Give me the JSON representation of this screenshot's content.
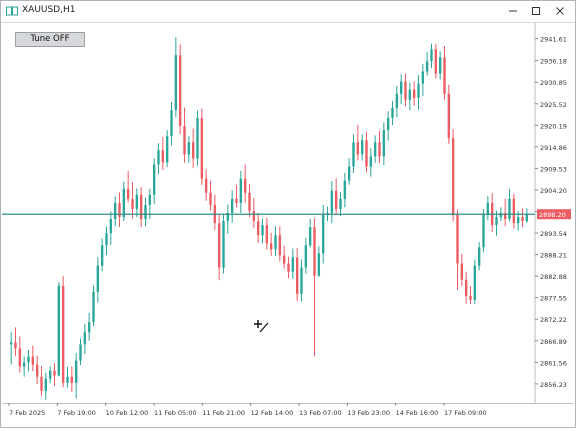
{
  "window": {
    "title": "XAUUSD,H1",
    "controls": {
      "minimize": "minimize-icon",
      "maximize": "maximize-icon",
      "close": "close-icon"
    }
  },
  "toolbar": {
    "tune_label": "Tune OFF"
  },
  "colors": {
    "bull": "#2aa69a",
    "bear": "#ec5c63",
    "grid_border": "#b8bec4",
    "price_line": "#2f8f83",
    "price_label_bg": "#ec5c63"
  },
  "chart_data": {
    "type": "candlestick",
    "symbol": "XAUUSD",
    "timeframe": "H1",
    "ylim": [
      2851.5,
      2945.5
    ],
    "y_ticks": [
      "2941.61",
      "2936.18",
      "2930.85",
      "2925.52",
      "2920.19",
      "2914.86",
      "2909.53",
      "2904.20",
      "2898.87",
      "2893.54",
      "2888.21",
      "2882.88",
      "2877.55",
      "2872.22",
      "2866.89",
      "2861.56",
      "2856.23"
    ],
    "x_ticks": [
      "7 Feb 2025",
      "7 Feb 19:00",
      "10 Feb 12:00",
      "11 Feb 05:00",
      "11 Feb 21:00",
      "12 Feb 14:00",
      "13 Feb 07:00",
      "13 Feb 23:00",
      "14 Feb 16:00",
      "17 Feb 09:00"
    ],
    "current_price": "2898.20",
    "current_price_value": 2898.2,
    "cursor_icon": "crosshair-cursor-icon",
    "candles": [
      [
        2866.0,
        2869.0,
        2861.0,
        2866.5
      ],
      [
        2866.5,
        2870.2,
        2863.2,
        2865.0
      ],
      [
        2865.0,
        2868.0,
        2859.0,
        2860.5
      ],
      [
        2860.5,
        2863.0,
        2858.0,
        2861.5
      ],
      [
        2861.5,
        2864.6,
        2859.3,
        2863.0
      ],
      [
        2863.0,
        2865.7,
        2859.4,
        2861.0
      ],
      [
        2861.0,
        2863.2,
        2856.2,
        2858.0
      ],
      [
        2858.0,
        2860.7,
        2853.2,
        2854.5
      ],
      [
        2854.5,
        2859.0,
        2852.3,
        2857.5
      ],
      [
        2857.5,
        2860.6,
        2856.4,
        2859.5
      ],
      [
        2859.5,
        2861.4,
        2855.6,
        2858.3
      ],
      [
        2858.3,
        2881.4,
        2858.1,
        2880.5
      ],
      [
        2880.5,
        2882.9,
        2855.4,
        2856.5
      ],
      [
        2856.5,
        2860.5,
        2855.3,
        2858.0
      ],
      [
        2858.0,
        2860.6,
        2854.2,
        2856.5
      ],
      [
        2856.5,
        2863.9,
        2852.6,
        2862.0
      ],
      [
        2862.0,
        2867.5,
        2860.9,
        2866.0
      ],
      [
        2866.0,
        2871.1,
        2863.6,
        2869.0
      ],
      [
        2869.0,
        2873.8,
        2866.9,
        2871.5
      ],
      [
        2871.5,
        2880.6,
        2870.5,
        2879.0
      ],
      [
        2879.0,
        2887.6,
        2876.3,
        2885.5
      ],
      [
        2885.5,
        2892.2,
        2884.1,
        2890.5
      ],
      [
        2890.5,
        2895.2,
        2888.1,
        2893.5
      ],
      [
        2893.5,
        2898.9,
        2890.6,
        2897.0
      ],
      [
        2897.0,
        2902.6,
        2895.2,
        2901.0
      ],
      [
        2901.0,
        2903.6,
        2895.0,
        2897.5
      ],
      [
        2897.5,
        2906.3,
        2896.5,
        2904.5
      ],
      [
        2904.5,
        2908.9,
        2901.1,
        2902.0
      ],
      [
        2902.0,
        2906.2,
        2897.1,
        2899.5
      ],
      [
        2899.5,
        2904.6,
        2897.5,
        2903.0
      ],
      [
        2903.0,
        2904.9,
        2895.0,
        2897.0
      ],
      [
        2897.0,
        2902.3,
        2895.2,
        2900.5
      ],
      [
        2900.5,
        2904.5,
        2897.0,
        2903.0
      ],
      [
        2903.0,
        2912.0,
        2900.7,
        2910.5
      ],
      [
        2910.5,
        2915.8,
        2908.1,
        2914.0
      ],
      [
        2914.0,
        2917.3,
        2909.1,
        2911.0
      ],
      [
        2911.0,
        2919.0,
        2909.9,
        2917.5
      ],
      [
        2917.5,
        2926.0,
        2915.2,
        2924.0
      ],
      [
        2924.0,
        2942.0,
        2922.2,
        2937.5
      ],
      [
        2937.5,
        2940.2,
        2918.0,
        2920.0
      ],
      [
        2920.0,
        2924.6,
        2910.9,
        2913.0
      ],
      [
        2913.0,
        2917.5,
        2910.9,
        2916.0
      ],
      [
        2916.0,
        2919.4,
        2909.6,
        2912.0
      ],
      [
        2912.0,
        2923.9,
        2910.2,
        2922.0
      ],
      [
        2922.0,
        2924.3,
        2905.4,
        2907.0
      ],
      [
        2907.0,
        2909.3,
        2901.5,
        2903.5
      ],
      [
        2903.5,
        2906.5,
        2899.1,
        2900.5
      ],
      [
        2900.5,
        2903.0,
        2894.3,
        2896.0
      ],
      [
        2896.0,
        2898.0,
        2881.9,
        2885.0
      ],
      [
        2885.0,
        2898.3,
        2883.5,
        2896.5
      ],
      [
        2896.5,
        2900.6,
        2893.3,
        2898.5
      ],
      [
        2898.5,
        2904.1,
        2896.1,
        2902.0
      ],
      [
        2902.0,
        2905.5,
        2899.9,
        2901.0
      ],
      [
        2901.0,
        2908.9,
        2898.5,
        2907.0
      ],
      [
        2907.0,
        2910.5,
        2901.1,
        2903.5
      ],
      [
        2903.5,
        2905.6,
        2897.4,
        2899.0
      ],
      [
        2899.0,
        2902.2,
        2894.8,
        2896.5
      ],
      [
        2896.5,
        2898.5,
        2891.1,
        2893.0
      ],
      [
        2893.0,
        2897.1,
        2891.0,
        2895.5
      ],
      [
        2895.5,
        2897.3,
        2889.4,
        2891.0
      ],
      [
        2891.0,
        2893.6,
        2887.9,
        2889.5
      ],
      [
        2889.5,
        2895.2,
        2887.9,
        2893.0
      ],
      [
        2893.0,
        2895.2,
        2886.5,
        2888.0
      ],
      [
        2888.0,
        2890.5,
        2884.7,
        2886.0
      ],
      [
        2886.0,
        2887.7,
        2882.4,
        2884.0
      ],
      [
        2884.0,
        2889.7,
        2882.2,
        2887.5
      ],
      [
        2887.5,
        2889.9,
        2876.7,
        2878.5
      ],
      [
        2878.5,
        2887.0,
        2876.6,
        2885.0
      ],
      [
        2885.0,
        2892.4,
        2883.5,
        2890.5
      ],
      [
        2890.5,
        2897.1,
        2890.0,
        2895.0
      ],
      [
        2895.0,
        2897.2,
        2863.0,
        2883.0
      ],
      [
        2883.0,
        2890.3,
        2882.7,
        2888.5
      ],
      [
        2888.5,
        2900.5,
        2886.0,
        2898.0
      ],
      [
        2898.0,
        2900.1,
        2896.5,
        2898.5
      ],
      [
        2898.5,
        2906.4,
        2896.0,
        2904.0
      ],
      [
        2904.0,
        2907.1,
        2898.0,
        2899.5
      ],
      [
        2899.5,
        2903.7,
        2897.7,
        2902.0
      ],
      [
        2902.0,
        2908.4,
        2899.9,
        2906.5
      ],
      [
        2906.5,
        2912.1,
        2905.5,
        2910.0
      ],
      [
        2910.0,
        2917.9,
        2908.4,
        2916.0
      ],
      [
        2916.0,
        2920.3,
        2911.5,
        2913.0
      ],
      [
        2913.0,
        2918.0,
        2911.5,
        2916.5
      ],
      [
        2916.5,
        2918.6,
        2908.5,
        2910.0
      ],
      [
        2910.0,
        2914.5,
        2907.5,
        2912.5
      ],
      [
        2912.5,
        2917.7,
        2910.9,
        2916.0
      ],
      [
        2916.0,
        2918.8,
        2910.8,
        2912.5
      ],
      [
        2912.5,
        2920.9,
        2910.3,
        2919.0
      ],
      [
        2919.0,
        2923.7,
        2916.4,
        2922.0
      ],
      [
        2922.0,
        2926.2,
        2920.2,
        2924.5
      ],
      [
        2924.5,
        2929.9,
        2922.2,
        2928.0
      ],
      [
        2928.0,
        2932.8,
        2925.4,
        2931.0
      ],
      [
        2931.0,
        2933.0,
        2924.9,
        2926.5
      ],
      [
        2926.5,
        2930.8,
        2923.9,
        2929.0
      ],
      [
        2929.0,
        2931.1,
        2925.0,
        2927.0
      ],
      [
        2927.0,
        2932.6,
        2924.0,
        2930.5
      ],
      [
        2930.5,
        2935.4,
        2927.4,
        2933.5
      ],
      [
        2933.5,
        2938.4,
        2932.5,
        2936.0
      ],
      [
        2936.0,
        2940.4,
        2934.3,
        2939.0
      ],
      [
        2939.0,
        2940.3,
        2931.8,
        2933.0
      ],
      [
        2933.0,
        2938.5,
        2931.5,
        2937.0
      ],
      [
        2937.0,
        2939.8,
        2926.4,
        2928.0
      ],
      [
        2928.0,
        2930.2,
        2915.6,
        2917.0
      ],
      [
        2917.0,
        2919.2,
        2896.4,
        2898.0
      ],
      [
        2898.0,
        2899.4,
        2879.4,
        2886.0
      ],
      [
        2886.0,
        2888.4,
        2880.4,
        2882.0
      ],
      [
        2882.0,
        2884.0,
        2876.1,
        2878.0
      ],
      [
        2878.0,
        2880.4,
        2876.0,
        2877.0
      ],
      [
        2877.0,
        2887.0,
        2876.0,
        2885.5
      ],
      [
        2885.5,
        2891.3,
        2884.3,
        2890.0
      ],
      [
        2890.0,
        2899.5,
        2888.8,
        2898.0
      ],
      [
        2898.0,
        2902.7,
        2896.7,
        2901.0
      ],
      [
        2901.0,
        2903.4,
        2893.8,
        2895.5
      ],
      [
        2895.5,
        2899.1,
        2892.9,
        2897.5
      ],
      [
        2897.5,
        2899.9,
        2896.5,
        2898.5
      ],
      [
        2898.5,
        2902.0,
        2895.2,
        2897.0
      ],
      [
        2897.0,
        2904.5,
        2896.5,
        2902.0
      ],
      [
        2902.0,
        2903.2,
        2894.6,
        2896.0
      ],
      [
        2896.0,
        2899.0,
        2894.1,
        2897.5
      ],
      [
        2897.5,
        2899.6,
        2895.0,
        2896.5
      ],
      [
        2896.5,
        2899.7,
        2896.1,
        2898.2
      ]
    ]
  }
}
